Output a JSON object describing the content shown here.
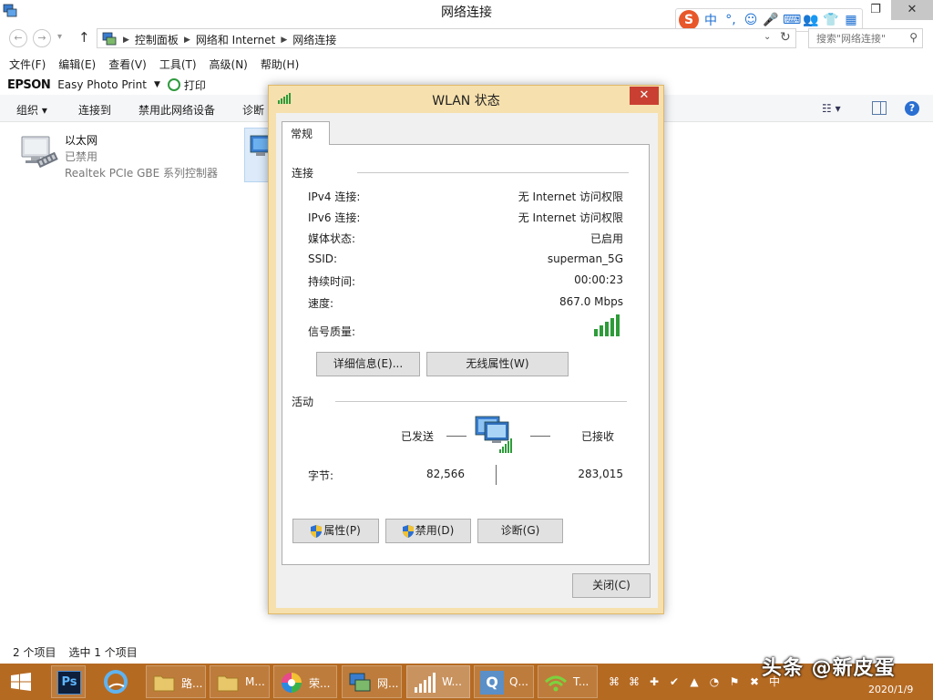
{
  "window": {
    "title": "网络连接"
  },
  "ime": {
    "logo": "S",
    "lang": "中",
    "punct": "°,",
    "emoji": "☺",
    "mic": "🎤",
    "keyboard": "⌨",
    "user": "👥",
    "skin": "👕",
    "grid": "▦"
  },
  "address": {
    "crumbs": [
      "控制面板",
      "网络和 Internet",
      "网络连接"
    ],
    "search_placeholder": "搜索\"网络连接\""
  },
  "menu": [
    "文件(F)",
    "编辑(E)",
    "查看(V)",
    "工具(T)",
    "高级(N)",
    "帮助(H)"
  ],
  "epson": {
    "brand": "EPSON",
    "app": "Easy Photo Print",
    "print": "打印"
  },
  "commands": {
    "organize": "组织 ▾",
    "connect": "连接到",
    "disable": "禁用此网络设备",
    "diagnose": "诊断"
  },
  "items": {
    "ethernet": {
      "name": "以太网",
      "state": "已禁用",
      "device": "Realtek PCIe GBE 系列控制器"
    }
  },
  "statusbar": {
    "count": "2 个项目",
    "selected": "选中 1 个项目"
  },
  "dialog": {
    "title": "WLAN 状态",
    "tab": "常规",
    "connection_title": "连接",
    "rows": [
      {
        "label": "IPv4 连接:",
        "value": "无 Internet 访问权限"
      },
      {
        "label": "IPv6 连接:",
        "value": "无 Internet 访问权限"
      },
      {
        "label": "媒体状态:",
        "value": "已启用"
      },
      {
        "label": "SSID:",
        "value": "superman_5G"
      },
      {
        "label": "持续时间:",
        "value": "00:00:23"
      },
      {
        "label": "速度:",
        "value": "867.0 Mbps"
      }
    ],
    "signal_label": "信号质量:",
    "signal_level": 5,
    "signal_max": 5,
    "details_button": "详细信息(E)...",
    "wireless_button": "无线属性(W)",
    "activity_title": "活动",
    "sent_label": "已发送",
    "received_label": "已接收",
    "bytes_label": "字节:",
    "bytes_sent": "82,566",
    "bytes_received": "283,015",
    "properties_button": "属性(P)",
    "disable_button": "禁用(D)",
    "diagnose_button": "诊断(G)",
    "close_button": "关闭(C)"
  },
  "taskbar": {
    "folder1": "路...",
    "folder2": "M...",
    "app": "荣...",
    "net": "网...",
    "wlan": "W...",
    "q": "Q...",
    "t": "T...",
    "date": "2020/1/9",
    "ime_lang": "中"
  },
  "watermark": "头条 @新皮蛋",
  "colors": {
    "dialog_frame": "#f6e0ad",
    "taskbar": "#b56a22",
    "close_red": "#c94032",
    "signal_green": "#2e9b3a"
  }
}
